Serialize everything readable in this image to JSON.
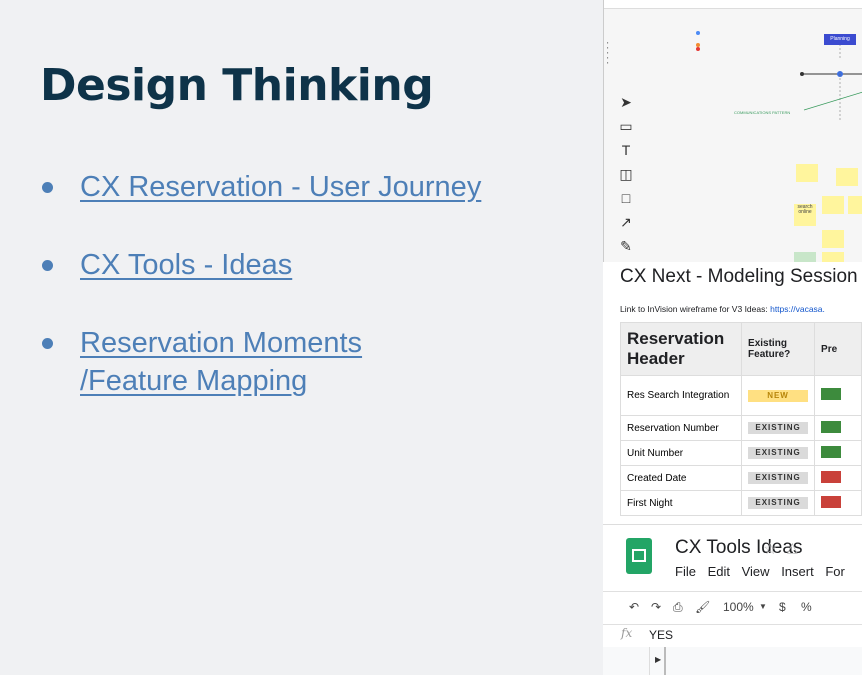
{
  "slide": {
    "title": "Design Thinking",
    "bullets": [
      {
        "line1": "CX Reservation - User Journey",
        "line2": ""
      },
      {
        "line1": "CX Tools - Ideas",
        "line2": ""
      },
      {
        "line1": "Reservation Moments",
        "line2": "/Feature Mapping"
      }
    ],
    "bullet_color": "#4d7fb7",
    "title_color": "#0e3349"
  },
  "whiteboard": {
    "planning_label": "Planning",
    "communications_label": "COMMUNICATIONS PATTERN",
    "sticky_search": "search online",
    "tools": [
      "select-tool-icon",
      "frame-tool-icon",
      "text-tool-icon",
      "sticky-note-icon",
      "rectangle-tool-icon",
      "arrow-tool-icon",
      "pen-tool-icon"
    ]
  },
  "doc": {
    "heading": "CX Next - Modeling Session",
    "link_prefix": "Link to InVision wireframe for V3 Ideas: ",
    "link_url": "https://vacasa.",
    "table": {
      "header_main": "Reservation Header",
      "header_existing": "Existing Feature?",
      "header_pre": "Pre",
      "rows": [
        {
          "label": "Res Search Integration",
          "status": "NEW",
          "color": "#3d8b3d"
        },
        {
          "label": "Reservation Number",
          "status": "EXISTING",
          "color": "#3d8b3d"
        },
        {
          "label": "Unit Number",
          "status": "EXISTING",
          "color": "#3d8b3d"
        },
        {
          "label": "Created Date",
          "status": "EXISTING",
          "color": "#c9413a"
        },
        {
          "label": "First Night",
          "status": "EXISTING",
          "color": "#c9413a"
        }
      ]
    }
  },
  "sheets": {
    "title": "CX Tools Ideas",
    "menus": [
      "File",
      "Edit",
      "View",
      "Insert",
      "For"
    ],
    "zoom": "100%",
    "currency": "$",
    "percent": "%",
    "formula_value": "YES",
    "fx_label": "fx"
  }
}
